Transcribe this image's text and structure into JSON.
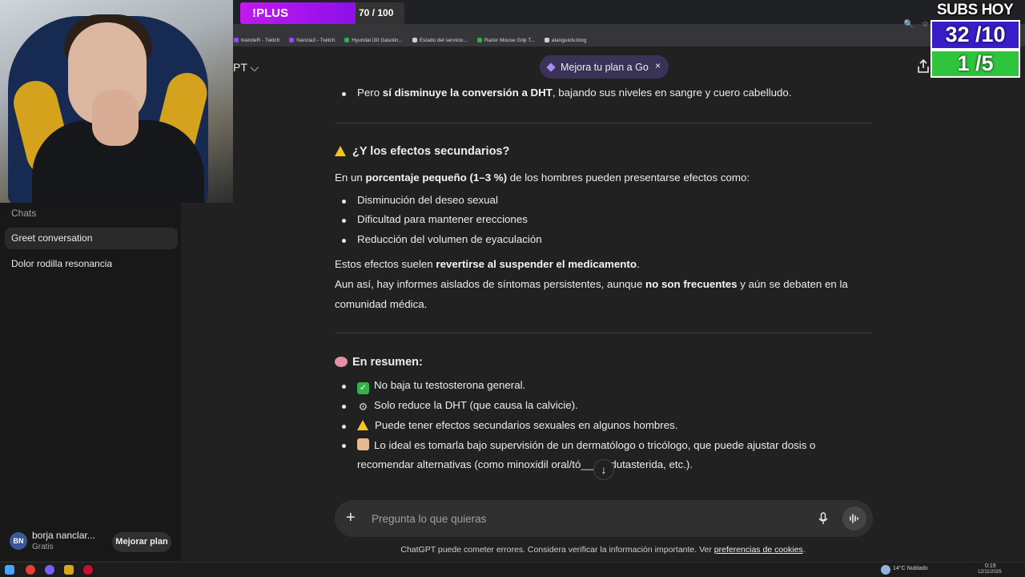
{
  "overlay": {
    "plus_label": "!PLUS",
    "plus_count": "70 / 100",
    "plus_progress": 0.7,
    "subs_title": "SUBS HOY",
    "subs_count": "32 /10",
    "subs_secondary": "1 /5",
    "colors": {
      "plus": "#c218f2",
      "subs_primary": "#3a1cc8",
      "subs_secondary": "#2ec43b"
    }
  },
  "browser": {
    "bookmarks": [
      "tvandeR - Twitch",
      "Nancla3 - Twitch",
      "Hyundai i30 Gasolin...",
      "Estado del servicio...",
      "Razer Mouse Grip T...",
      "alanguiotv.blog"
    ]
  },
  "sidebar": {
    "heading": "Chats",
    "items": [
      {
        "label": "Greet conversation",
        "active": true
      },
      {
        "label": "Dolor rodilla resonancia",
        "active": false
      }
    ],
    "user": {
      "initials": "BN",
      "name": "borja nanclar...",
      "plan": "Gratis"
    },
    "upgrade_label": "Mejorar plan"
  },
  "header": {
    "model_label": "PT ⌵",
    "promo_label": "Mejora tu plan a Go",
    "promo_close": "×"
  },
  "message": {
    "top_bullet": {
      "pre": "Pero ",
      "bold": "sí disminuye la conversión a DHT",
      "post": ", bajando sus niveles en sangre y cuero cabelludo."
    },
    "side_effects_heading": "¿Y los efectos secundarios?",
    "side_effects_intro": {
      "pre": "En un ",
      "bold": "porcentaje pequeño (1–3 %)",
      "post": " de los hombres pueden presentarse efectos como:"
    },
    "side_effects": [
      "Disminución del deseo sexual",
      "Dificultad para mantener erecciones",
      "Reducción del volumen de eyaculación"
    ],
    "reversible": {
      "pre": "Estos efectos suelen ",
      "bold": "revertirse al suspender el medicamento",
      "post": "."
    },
    "persistent_line1": {
      "pre": "Aun así, hay informes aislados de síntomas persistentes, aunque ",
      "bold": "no son frecuentes",
      "post": " y aún se debaten en la"
    },
    "persistent_line2": "comunidad médica.",
    "summary_heading": "En resumen:",
    "summary": [
      {
        "icon": "check-mark-icon",
        "text": "No baja tu testosterona general."
      },
      {
        "icon": "gear-icon",
        "text": "Solo reduce la DHT (que causa la calvicie)."
      },
      {
        "icon": "warning-icon",
        "text": "Puede tener efectos secundarios sexuales en algunos hombres."
      },
      {
        "icon": "doctor-icon",
        "text": "Lo ideal es tomarla bajo supervisión de un dermatólogo o tricólogo, que puede ajustar dosis o"
      }
    ],
    "summary_last_line": "recomendar alternativas (como minoxidil oral/tó___o, dutasterida, etc.)."
  },
  "composer": {
    "placeholder": "Pregunta lo que quieras",
    "disclaimer_text": "ChatGPT puede cometer errores. Considera verificar la información importante. Ver ",
    "disclaimer_link": "preferencias de cookies",
    "disclaimer_end": "."
  },
  "taskbar": {
    "weather": "14°C  Nublado",
    "time": "0:19",
    "date": "12/11/2025"
  }
}
